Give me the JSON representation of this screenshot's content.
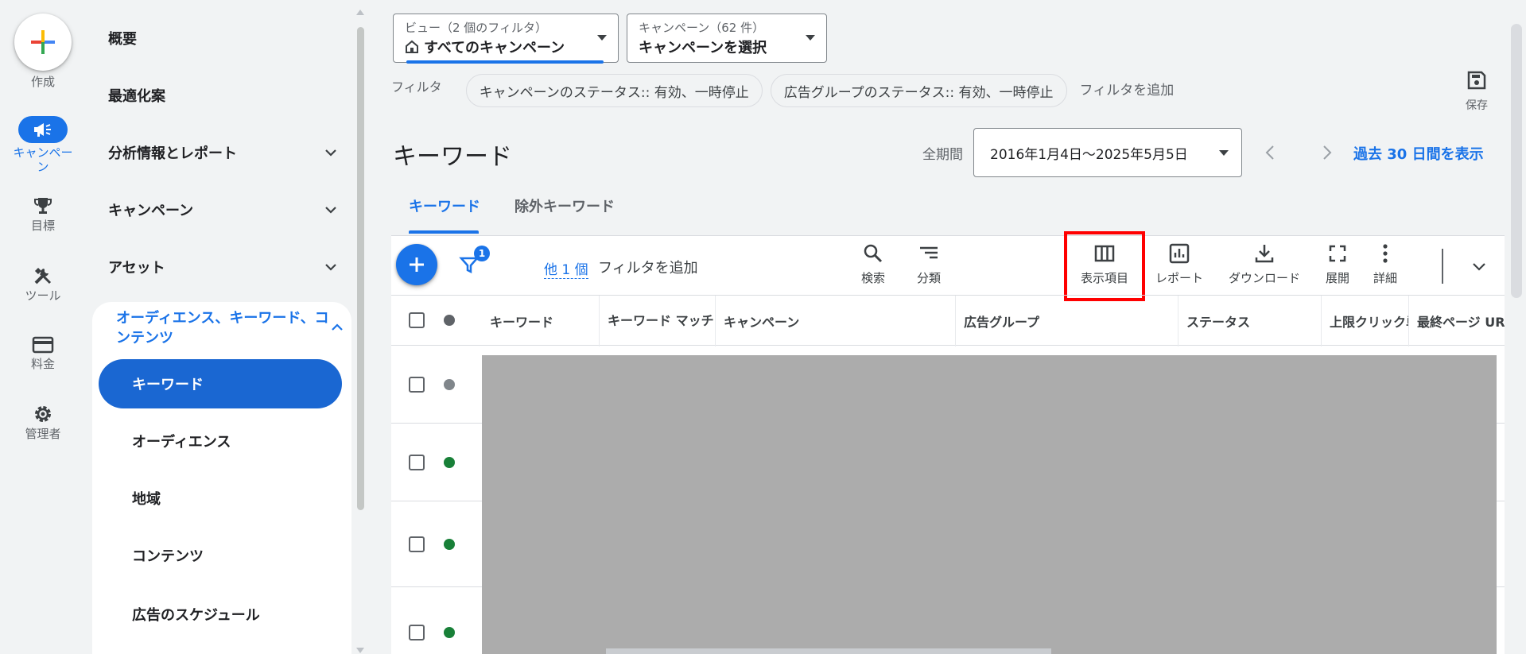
{
  "rail": {
    "create_label": "作成",
    "items": [
      {
        "label": "キャンペーン",
        "icon": "megaphone-icon",
        "active": true
      },
      {
        "label": "目標",
        "icon": "trophy-icon",
        "active": false
      },
      {
        "label": "ツール",
        "icon": "tools-icon",
        "active": false
      },
      {
        "label": "料金",
        "icon": "credit-card-icon",
        "active": false
      },
      {
        "label": "管理者",
        "icon": "gear-icon",
        "active": false
      }
    ]
  },
  "nav": {
    "items": [
      {
        "label": "概要",
        "expandable": false
      },
      {
        "label": "最適化案",
        "expandable": false
      },
      {
        "label": "分析情報とレポート",
        "expandable": true
      },
      {
        "label": "キャンペーン",
        "expandable": true
      },
      {
        "label": "アセット",
        "expandable": true
      }
    ],
    "section": {
      "label": "オーディエンス、キーワード、コンテンツ",
      "sub_items": [
        {
          "label": "キーワード",
          "active": true
        },
        {
          "label": "オーディエンス",
          "active": false
        },
        {
          "label": "地域",
          "active": false
        },
        {
          "label": "コンテンツ",
          "active": false
        },
        {
          "label": "広告のスケジュール",
          "active": false
        }
      ]
    }
  },
  "header": {
    "view_selector": {
      "label": "ビュー（2 個のフィルタ）",
      "value": "すべてのキャンペーン"
    },
    "campaign_selector": {
      "label": "キャンペーン（62 件）",
      "value": "キャンペーンを選択"
    },
    "filter_label": "フィルタ",
    "chips": [
      "キャンペーンのステータス:: 有効、一時停止",
      "広告グループのステータス:: 有効、一時停止"
    ],
    "add_filter": "フィルタを追加",
    "save_label": "保存"
  },
  "page": {
    "title": "キーワード",
    "period_label": "全期間",
    "date_range": "2016年1月4日～2025年5月5日",
    "last30_link": "過去 30 日間を表示"
  },
  "tabs": [
    "キーワード",
    "除外キーワード"
  ],
  "toolbar": {
    "filter_badge": "1",
    "others_link": "他 1 個",
    "add_filter": "フィルタを追加",
    "tools": [
      {
        "label": "検索",
        "icon": "search-icon"
      },
      {
        "label": "分類",
        "icon": "segment-icon"
      },
      {
        "label": "表示項目",
        "icon": "columns-icon"
      },
      {
        "label": "レポート",
        "icon": "report-icon"
      },
      {
        "label": "ダウンロード",
        "icon": "download-icon"
      },
      {
        "label": "展開",
        "icon": "expand-icon"
      },
      {
        "label": "詳細",
        "icon": "more-vert-icon"
      }
    ]
  },
  "table": {
    "columns": [
      "キーワード",
      "キーワード マッチ",
      "キャンペーン",
      "広告グループ",
      "ステータス",
      "上限クリック単価",
      "最終ページ URL"
    ],
    "rows": [
      {
        "status": "paused"
      },
      {
        "status": "enabled"
      },
      {
        "status": "enabled"
      },
      {
        "status": "enabled"
      }
    ]
  },
  "colors": {
    "accent": "#1a73e8",
    "enabled": "#188038",
    "paused": "#80868b",
    "highlight": "#ff0000"
  }
}
